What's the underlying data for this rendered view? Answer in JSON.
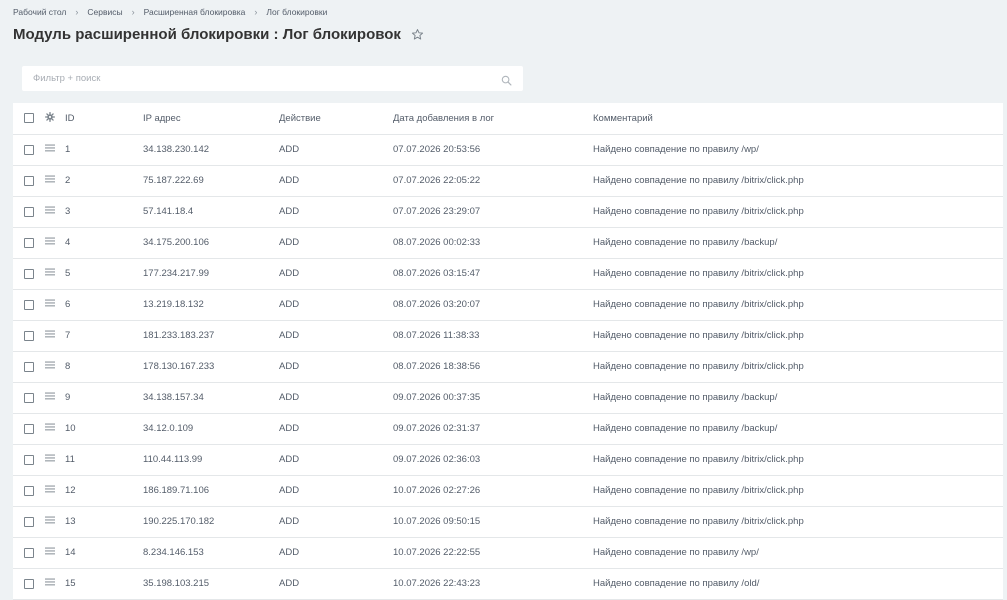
{
  "breadcrumb": [
    "Рабочий стол",
    "Сервисы",
    "Расширенная блокировка",
    "Лог блокировки"
  ],
  "page_title": "Модуль расширенной блокировки : Лог блокировок",
  "filter": {
    "placeholder": "Фильтр + поиск"
  },
  "table": {
    "headers": {
      "id": "ID",
      "ip": "IP адрес",
      "action": "Действие",
      "date": "Дата добавления в лог",
      "comment": "Комментарий"
    },
    "rows": [
      {
        "id": "1",
        "ip": "34.138.230.142",
        "action": "ADD",
        "date": "07.07.2026 20:53:56",
        "comment": "Найдено совпадение по правилу /wp/"
      },
      {
        "id": "2",
        "ip": "75.187.222.69",
        "action": "ADD",
        "date": "07.07.2026 22:05:22",
        "comment": "Найдено совпадение по правилу /bitrix/click.php"
      },
      {
        "id": "3",
        "ip": "57.141.18.4",
        "action": "ADD",
        "date": "07.07.2026 23:29:07",
        "comment": "Найдено совпадение по правилу /bitrix/click.php"
      },
      {
        "id": "4",
        "ip": "34.175.200.106",
        "action": "ADD",
        "date": "08.07.2026 00:02:33",
        "comment": "Найдено совпадение по правилу /backup/"
      },
      {
        "id": "5",
        "ip": "177.234.217.99",
        "action": "ADD",
        "date": "08.07.2026 03:15:47",
        "comment": "Найдено совпадение по правилу /bitrix/click.php"
      },
      {
        "id": "6",
        "ip": "13.219.18.132",
        "action": "ADD",
        "date": "08.07.2026 03:20:07",
        "comment": "Найдено совпадение по правилу /bitrix/click.php"
      },
      {
        "id": "7",
        "ip": "181.233.183.237",
        "action": "ADD",
        "date": "08.07.2026 11:38:33",
        "comment": "Найдено совпадение по правилу /bitrix/click.php"
      },
      {
        "id": "8",
        "ip": "178.130.167.233",
        "action": "ADD",
        "date": "08.07.2026 18:38:56",
        "comment": "Найдено совпадение по правилу /bitrix/click.php"
      },
      {
        "id": "9",
        "ip": "34.138.157.34",
        "action": "ADD",
        "date": "09.07.2026 00:37:35",
        "comment": "Найдено совпадение по правилу /backup/"
      },
      {
        "id": "10",
        "ip": "34.12.0.109",
        "action": "ADD",
        "date": "09.07.2026 02:31:37",
        "comment": "Найдено совпадение по правилу /backup/"
      },
      {
        "id": "11",
        "ip": "110.44.113.99",
        "action": "ADD",
        "date": "09.07.2026 02:36:03",
        "comment": "Найдено совпадение по правилу /bitrix/click.php"
      },
      {
        "id": "12",
        "ip": "186.189.71.106",
        "action": "ADD",
        "date": "10.07.2026 02:27:26",
        "comment": "Найдено совпадение по правилу /bitrix/click.php"
      },
      {
        "id": "13",
        "ip": "190.225.170.182",
        "action": "ADD",
        "date": "10.07.2026 09:50:15",
        "comment": "Найдено совпадение по правилу /bitrix/click.php"
      },
      {
        "id": "14",
        "ip": "8.234.146.153",
        "action": "ADD",
        "date": "10.07.2026 22:22:55",
        "comment": "Найдено совпадение по правилу /wp/"
      },
      {
        "id": "15",
        "ip": "35.198.103.215",
        "action": "ADD",
        "date": "10.07.2026 22:43:23",
        "comment": "Найдено совпадение по правилу /old/"
      }
    ]
  },
  "icons": {
    "title": "star-icon",
    "search": "search-icon",
    "settings": "gear-icon",
    "row_menu": "menu-icon"
  },
  "colors": {
    "background": "#eef2f4",
    "text": "#535c69",
    "title": "#333333",
    "border": "#e4e7e9"
  }
}
